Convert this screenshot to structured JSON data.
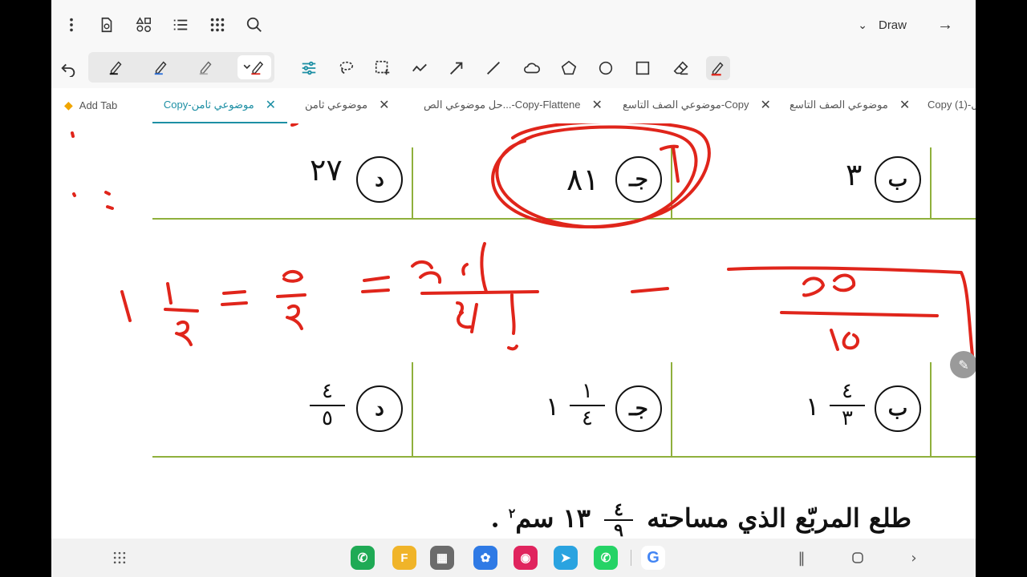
{
  "topbar": {
    "icons": [
      "more-vert-icon",
      "document-settings-icon",
      "shapes-icon",
      "list-icon",
      "grid-icon",
      "search-icon"
    ],
    "draw_label": "Draw"
  },
  "toolbar": {
    "pens": [
      {
        "icon": "pen-black-icon",
        "color": "#111111"
      },
      {
        "icon": "pen-blue-icon",
        "color": "#2a6fdb"
      },
      {
        "icon": "pen-grey-icon",
        "color": "#9a9a9a"
      },
      {
        "icon": "pen-red-icon",
        "color": "#e0251b"
      }
    ],
    "tools": [
      "adjust-icon",
      "lasso-icon",
      "select-rect-icon",
      "freehand-line-icon",
      "arrow-icon",
      "line-icon",
      "cloud-icon",
      "pentagon-icon",
      "circle-icon",
      "square-icon",
      "eraser-icon",
      "highlighter-icon"
    ]
  },
  "tabs": {
    "add_tab": "Add Tab",
    "items": [
      {
        "label": "Copy-موضوعي ثامن",
        "active": true
      },
      {
        "label": "موضوعي ثامن",
        "active": false
      },
      {
        "label": "حل موضوعي الص...-Copy-Flattene",
        "active": false
      },
      {
        "label": "موضوعي الصف التاسع-Copy",
        "active": false
      },
      {
        "label": "موضوعي الصف التاسع",
        "active": false
      },
      {
        "label": "Copy (1)-ل",
        "active": false
      }
    ]
  },
  "worksheet": {
    "row1": {
      "d": {
        "letter": "د",
        "value": "٢٧"
      },
      "j": {
        "letter": "جـ",
        "value": "٨١"
      },
      "b": {
        "letter": "ب",
        "value": "٣"
      }
    },
    "row2": {
      "d": {
        "letter": "د",
        "num": "٤",
        "den": "٥"
      },
      "j": {
        "letter": "جـ",
        "whole": "١",
        "num": "١",
        "den": "٤"
      },
      "b": {
        "letter": "ب",
        "whole": "١",
        "num": "٤",
        "den": "٣"
      }
    },
    "question_text": "طلع المربّع الذي مساحته",
    "question_whole": "١٣",
    "question_num": "٤",
    "question_den": "٩",
    "question_unit": "سم",
    "question_exp": "٢"
  },
  "ink_color": "#e0251b",
  "navbar": {
    "apps": [
      {
        "icon": "phone-app-icon",
        "color": "#1faa55",
        "glyph": "✆"
      },
      {
        "icon": "files-app-icon",
        "color": "#f0b429",
        "glyph": "F"
      },
      {
        "icon": "calculator-app-icon",
        "color": "#6b6b6b",
        "glyph": "▦"
      },
      {
        "icon": "gallery-app-icon",
        "color": "#2f7ae5",
        "glyph": "✿"
      },
      {
        "icon": "camera-app-icon",
        "color": "#e0245e",
        "glyph": "◉"
      },
      {
        "icon": "telegram-app-icon",
        "color": "#2aa3e0",
        "glyph": "➤"
      },
      {
        "icon": "whatsapp-app-icon",
        "color": "#25d366",
        "glyph": "✆"
      },
      {
        "icon": "google-app-icon",
        "color": "#ffffff",
        "glyph": "G"
      }
    ]
  }
}
